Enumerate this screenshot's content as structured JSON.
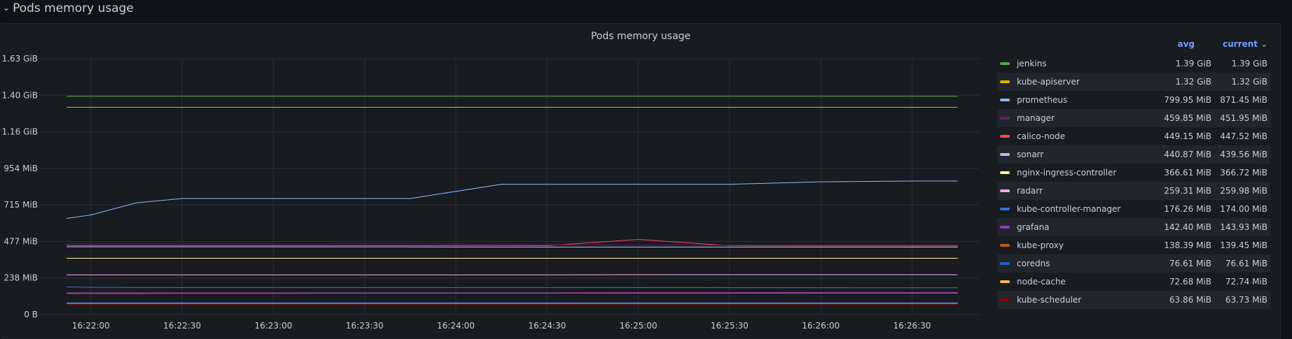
{
  "row": {
    "title": "Pods memory usage",
    "chevron_icon": "chevron-down-icon"
  },
  "panel": {
    "title": "Pods memory usage"
  },
  "legend": {
    "col_avg": "avg",
    "col_current": "current",
    "items": [
      {
        "name": "jenkins",
        "avg": "1.39 GiB",
        "current": "1.39 GiB",
        "color": "#56a64b"
      },
      {
        "name": "kube-apiserver",
        "avg": "1.32 GiB",
        "current": "1.32 GiB",
        "color": "#e0b400"
      },
      {
        "name": "prometheus",
        "avg": "799.95 MiB",
        "current": "871.45 MiB",
        "color": "#8ab8ff"
      },
      {
        "name": "manager",
        "avg": "459.85 MiB",
        "current": "451.95 MiB",
        "color": "#6d1f62"
      },
      {
        "name": "calico-node",
        "avg": "449.15 MiB",
        "current": "447.52 MiB",
        "color": "#f2495c"
      },
      {
        "name": "sonarr",
        "avg": "440.87 MiB",
        "current": "439.56 MiB",
        "color": "#b7b7ff"
      },
      {
        "name": "nginx-ingress-controller",
        "avg": "366.61 MiB",
        "current": "366.72 MiB",
        "color": "#ffee9f"
      },
      {
        "name": "radarr",
        "avg": "259.31 MiB",
        "current": "259.98 MiB",
        "color": "#ffa6e9"
      },
      {
        "name": "kube-controller-manager",
        "avg": "176.26 MiB",
        "current": "174.00 MiB",
        "color": "#3274d9"
      },
      {
        "name": "grafana",
        "avg": "142.40 MiB",
        "current": "143.93 MiB",
        "color": "#8f3bb8"
      },
      {
        "name": "kube-proxy",
        "avg": "138.39 MiB",
        "current": "139.45 MiB",
        "color": "#c15c17"
      },
      {
        "name": "coredns",
        "avg": "76.61 MiB",
        "current": "76.61 MiB",
        "color": "#1f60c4"
      },
      {
        "name": "node-cache",
        "avg": "72.68 MiB",
        "current": "72.74 MiB",
        "color": "#ffb357"
      },
      {
        "name": "kube-scheduler",
        "avg": "63.86 MiB",
        "current": "63.73 MiB",
        "color": "#8a0000"
      }
    ]
  },
  "chart_data": {
    "type": "line",
    "title": "Pods memory usage",
    "unit": "MiB",
    "y_ticks": [
      "0 B",
      "238 MiB",
      "477 MiB",
      "715 MiB",
      "954 MiB",
      "1.16 GiB",
      "1.40 GiB",
      "1.63 GiB"
    ],
    "ylim": [
      0,
      1669
    ],
    "x_ticks": [
      "16:22:00",
      "16:22:30",
      "16:23:00",
      "16:23:30",
      "16:24:00",
      "16:24:30",
      "16:25:00",
      "16:25:30",
      "16:26:00",
      "16:26:30"
    ],
    "x": [
      "16:21:52",
      "16:22:00",
      "16:22:15",
      "16:22:30",
      "16:23:00",
      "16:23:30",
      "16:23:45",
      "16:24:15",
      "16:24:30",
      "16:25:00",
      "16:25:30",
      "16:26:00",
      "16:26:30",
      "16:26:45"
    ],
    "series": [
      {
        "name": "jenkins",
        "color": "#56a64b",
        "values": [
          1424,
          1424,
          1424,
          1424,
          1424,
          1424,
          1424,
          1424,
          1424,
          1424,
          1424,
          1424,
          1424,
          1424
        ]
      },
      {
        "name": "kube-apiserver",
        "color": "#e0b400",
        "values": [
          1352,
          1352,
          1352,
          1352,
          1352,
          1352,
          1352,
          1352,
          1352,
          1352,
          1352,
          1352,
          1352,
          1352
        ]
      },
      {
        "name": "prometheus",
        "color": "#8ab8ff",
        "values": [
          627,
          650,
          729,
          757,
          757,
          757,
          757,
          850,
          850,
          850,
          850,
          866,
          871,
          871
        ]
      },
      {
        "name": "manager",
        "color": "#6d1f62",
        "values": [
          460,
          460,
          460,
          460,
          460,
          460,
          460,
          458,
          455,
          452,
          452,
          452,
          452,
          452
        ]
      },
      {
        "name": "calico-node",
        "color": "#f2495c",
        "values": [
          449,
          449,
          449,
          449,
          449,
          449,
          449,
          449,
          449,
          490,
          449,
          448,
          448,
          448
        ]
      },
      {
        "name": "sonarr",
        "color": "#b7b7ff",
        "values": [
          442,
          442,
          442,
          442,
          442,
          441,
          441,
          440,
          440,
          440,
          440,
          440,
          440,
          440
        ]
      },
      {
        "name": "nginx-ingress-controller",
        "color": "#ffee9f",
        "values": [
          367,
          367,
          367,
          367,
          367,
          367,
          367,
          367,
          367,
          367,
          367,
          367,
          367,
          367
        ]
      },
      {
        "name": "radarr",
        "color": "#ffa6e9",
        "values": [
          259,
          259,
          259,
          259,
          259,
          259,
          259,
          259,
          259,
          260,
          260,
          260,
          260,
          260
        ]
      },
      {
        "name": "kube-controller-manager",
        "color": "#3274d9",
        "values": [
          180,
          178,
          176,
          176,
          176,
          176,
          176,
          176,
          176,
          176,
          175,
          175,
          174,
          174
        ]
      },
      {
        "name": "grafana",
        "color": "#8f3bb8",
        "values": [
          142,
          142,
          142,
          142,
          142,
          142,
          142,
          142,
          142,
          143,
          143,
          144,
          144,
          144
        ]
      },
      {
        "name": "kube-proxy",
        "color": "#c15c17",
        "values": [
          137,
          137,
          137,
          138,
          138,
          139,
          139,
          139,
          139,
          139,
          139,
          139,
          139,
          139
        ]
      },
      {
        "name": "coredns",
        "color": "#1f60c4",
        "values": [
          77,
          77,
          77,
          77,
          77,
          77,
          77,
          77,
          77,
          77,
          77,
          77,
          77,
          77
        ]
      },
      {
        "name": "node-cache",
        "color": "#ffb357",
        "values": [
          73,
          73,
          73,
          73,
          73,
          73,
          73,
          73,
          73,
          73,
          73,
          73,
          73,
          73
        ]
      },
      {
        "name": "kube-scheduler",
        "color": "#8a0000",
        "values": [
          64,
          64,
          64,
          64,
          64,
          64,
          64,
          64,
          64,
          64,
          64,
          64,
          64,
          64
        ]
      }
    ]
  }
}
